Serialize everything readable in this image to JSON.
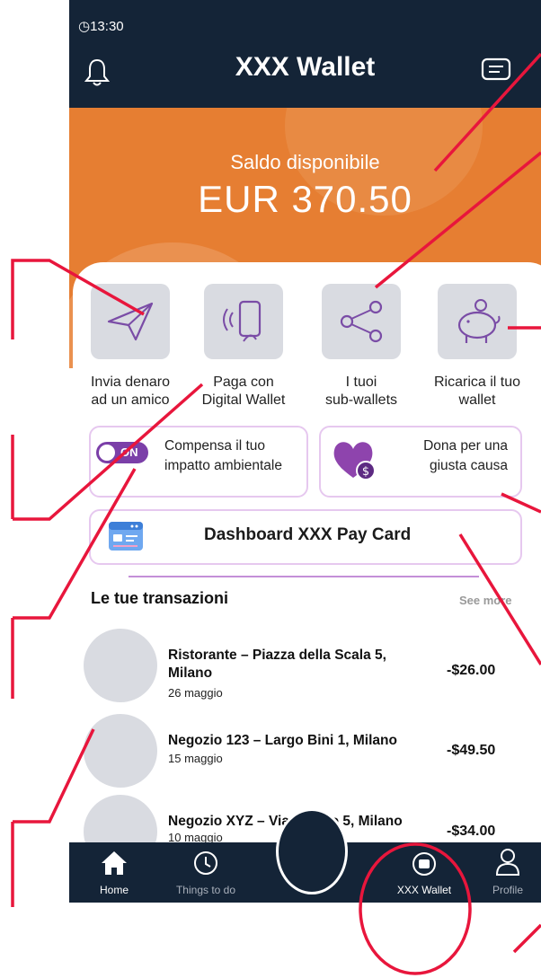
{
  "status": {
    "time": "13:30"
  },
  "header": {
    "title": "XXX Wallet"
  },
  "balance": {
    "label": "Saldo disponibile",
    "amount": "EUR 370.50"
  },
  "actions": [
    {
      "line1": "Invia denaro",
      "line2": "ad un amico",
      "icon": "paper-plane-icon"
    },
    {
      "line1": "Paga con",
      "line2": "Digital Wallet",
      "icon": "contactless-phone-icon"
    },
    {
      "line1": "I tuoi",
      "line2": "sub-wallets",
      "icon": "share-icon"
    },
    {
      "line1": "Ricarica il tuo",
      "line2": "wallet",
      "icon": "piggy-bank-icon"
    }
  ],
  "eco": {
    "toggle_text": "ON",
    "line1": "Compensa il tuo",
    "line2": "impatto ambientale"
  },
  "donate": {
    "line1": "Dona per una",
    "line2": "giusta causa"
  },
  "dashboard": {
    "label": "Dashboard XXX Pay Card"
  },
  "transactions": {
    "title": "Le tue transazioni",
    "see_more": "See more",
    "items": [
      {
        "name": "Ristorante – Piazza della Scala 5, Milano",
        "date": "26 maggio",
        "amount": "-$26.00"
      },
      {
        "name": "Negozio 123 – Largo Bini 1, Milano",
        "date": "15 maggio",
        "amount": "-$49.50"
      },
      {
        "name": "Negozio XYZ – Via Veneto 5, Milano",
        "date": "10 maggio",
        "amount": "-$34.00"
      }
    ]
  },
  "nav": {
    "home": "Home",
    "todo": "Things to do",
    "wallet": "XXX Wallet",
    "profile": "Profile"
  },
  "colors": {
    "header_bg": "#142437",
    "balance_bg": "#e67e32",
    "accent_purple": "#8e44ad",
    "annotation_red": "#e8163c"
  }
}
